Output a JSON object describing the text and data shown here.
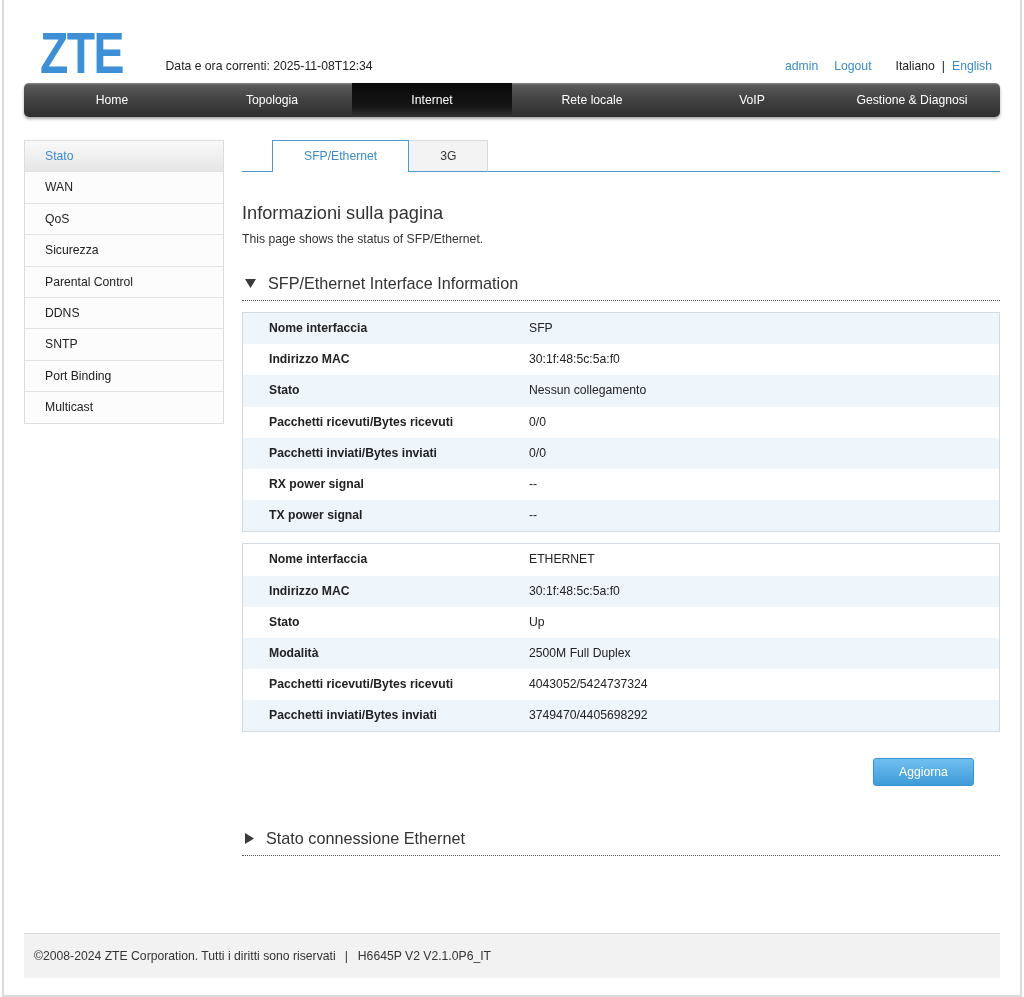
{
  "header": {
    "logo": "ZTE",
    "datetime": "Data e ora correnti: 2025-11-08T12:34",
    "user": "admin",
    "logout": "Logout",
    "languages": [
      {
        "label": "Italiano",
        "selected": true
      },
      {
        "label": "English",
        "selected": false
      }
    ],
    "language_separator": "|"
  },
  "nav": [
    {
      "label": "Home",
      "selected": false
    },
    {
      "label": "Topologia",
      "selected": false
    },
    {
      "label": "Internet",
      "selected": true
    },
    {
      "label": "Rete locale",
      "selected": false
    },
    {
      "label": "VoIP",
      "selected": false
    },
    {
      "label": "Gestione & Diagnosi",
      "selected": false
    }
  ],
  "sidebar": {
    "items": [
      {
        "label": "Stato",
        "selected": true
      },
      {
        "label": "WAN",
        "selected": false
      },
      {
        "label": "QoS",
        "selected": false
      },
      {
        "label": "Sicurezza",
        "selected": false
      },
      {
        "label": "Parental Control",
        "selected": false
      },
      {
        "label": "DDNS",
        "selected": false
      },
      {
        "label": "SNTP",
        "selected": false
      },
      {
        "label": "Port Binding",
        "selected": false
      },
      {
        "label": "Multicast",
        "selected": false
      }
    ]
  },
  "tabs": [
    {
      "label": "SFP/Ethernet",
      "selected": true
    },
    {
      "label": "3G",
      "selected": false
    }
  ],
  "page_info": {
    "title": "Informazioni sulla pagina",
    "description": "This page shows the status of SFP/Ethernet."
  },
  "sections": [
    {
      "title": "SFP/Ethernet Interface Information",
      "expanded": true,
      "tables": [
        {
          "rows": [
            {
              "label": "Nome interfaccia",
              "value": "SFP",
              "shaded": true
            },
            {
              "label": "Indirizzo MAC",
              "value": "30:1f:48:5c:5a:f0",
              "shaded": false
            },
            {
              "label": "Stato",
              "value": "Nessun collegamento",
              "shaded": true
            },
            {
              "label": "Pacchetti ricevuti/Bytes ricevuti",
              "value": "0/0",
              "shaded": false
            },
            {
              "label": "Pacchetti inviati/Bytes inviati",
              "value": "0/0",
              "shaded": true
            },
            {
              "label": "RX power signal",
              "value": "--",
              "shaded": false
            },
            {
              "label": "TX power signal",
              "value": "--",
              "shaded": true
            }
          ]
        },
        {
          "rows": [
            {
              "label": "Nome interfaccia",
              "value": "ETHERNET",
              "shaded": false
            },
            {
              "label": "Indirizzo MAC",
              "value": "30:1f:48:5c:5a:f0",
              "shaded": true
            },
            {
              "label": "Stato",
              "value": "Up",
              "shaded": false
            },
            {
              "label": "Modalità",
              "value": "2500M Full Duplex",
              "shaded": true
            },
            {
              "label": "Pacchetti ricevuti/Bytes ricevuti",
              "value": "4043052/5424737324",
              "shaded": false
            },
            {
              "label": "Pacchetti inviati/Bytes inviati",
              "value": "3749470/4405698292",
              "shaded": true
            }
          ]
        }
      ],
      "refresh_button": "Aggiorna"
    },
    {
      "title": "Stato connessione Ethernet",
      "expanded": false
    }
  ],
  "footer": {
    "copyright": "©2008-2024 ZTE Corporation. Tutti i diritti sono riservati",
    "separator": "|",
    "version": "H6645P V2 V2.1.0P6_IT"
  }
}
